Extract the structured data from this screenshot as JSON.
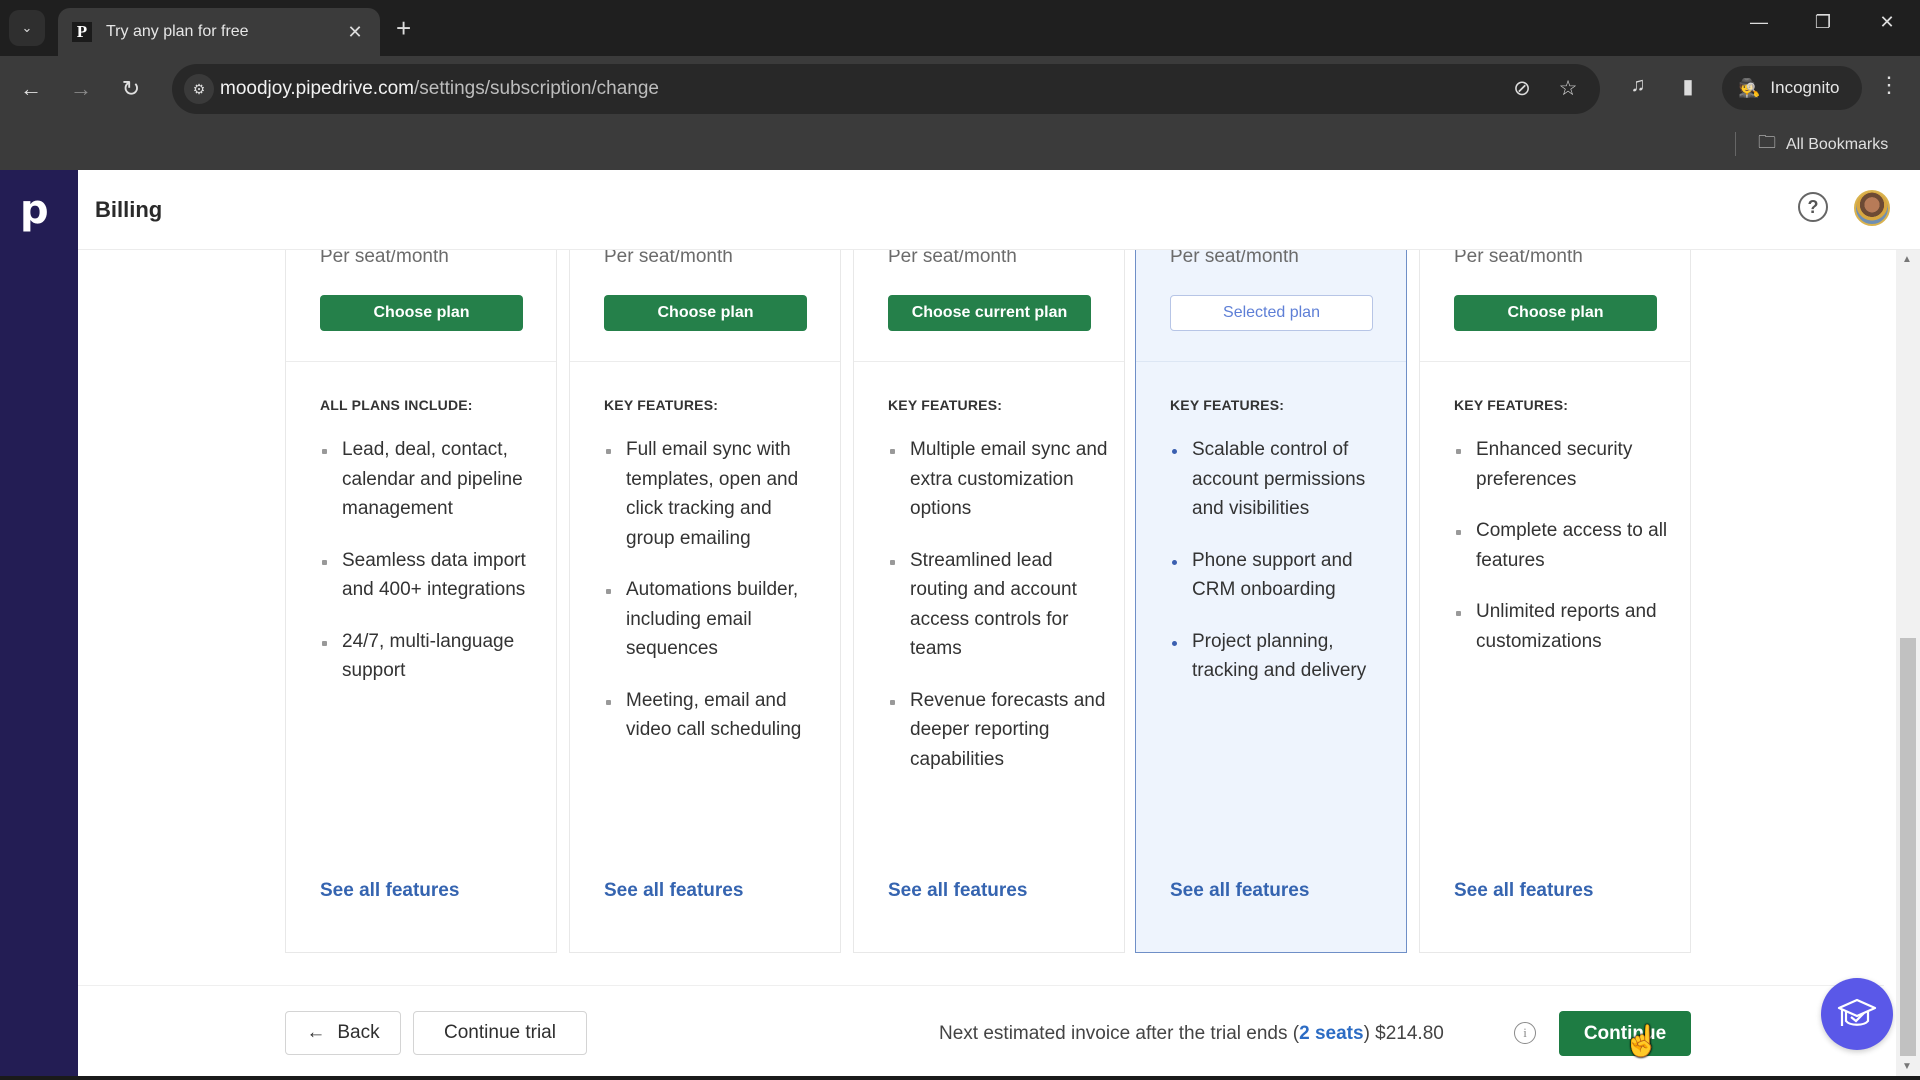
{
  "browser": {
    "tab": {
      "title": "Try any plan for free",
      "favicon": "P"
    },
    "url_host": "moodjoy.pipedrive.com",
    "url_path": "/settings/subscription/change",
    "profile_label": "Incognito",
    "bookmarks_label": "All Bookmarks",
    "icons": {
      "tab_list": "⌄",
      "close_tab": "✕",
      "new_tab": "+",
      "minimize": "—",
      "restore": "❐",
      "close_window": "✕",
      "back": "←",
      "forward": "→",
      "reload": "↻",
      "site_info": "⚙",
      "eye_off": "⊘",
      "star": "☆",
      "media": "♫",
      "side_panel": "▮",
      "incognito": "🕵",
      "menu": "⋮",
      "folder": "🗀"
    }
  },
  "app": {
    "logo": "p",
    "page_title": "Billing",
    "help_icon": "?"
  },
  "plans": [
    {
      "price_unit": "Per seat/month",
      "button_label": "Choose plan",
      "button_state": "choose",
      "features_heading": "ALL PLANS INCLUDE:",
      "features": [
        "Lead, deal, contact, calendar and pipeline management",
        "Seamless data import and 400+ integrations",
        "24/7, multi-language support"
      ],
      "see_all": "See all features"
    },
    {
      "price_unit": "Per seat/month",
      "button_label": "Choose plan",
      "button_state": "choose",
      "features_heading": "KEY FEATURES:",
      "features": [
        "Full email sync with templates, open and click tracking and group emailing",
        "Automations builder, including email sequences",
        "Meeting, email and video call scheduling"
      ],
      "see_all": "See all features"
    },
    {
      "price_unit": "Per seat/month",
      "button_label": "Choose current plan",
      "button_state": "current",
      "features_heading": "KEY FEATURES:",
      "features": [
        "Multiple email sync and extra customization options",
        "Streamlined lead routing and account access controls for teams",
        "Revenue forecasts and deeper reporting capabilities"
      ],
      "see_all": "See all features"
    },
    {
      "price_unit": "Per seat/month",
      "button_label": "Selected plan",
      "button_state": "selected",
      "features_heading": "KEY FEATURES:",
      "features": [
        "Scalable control of account permissions and visibilities",
        "Phone support and CRM onboarding",
        "Project planning, tracking and delivery"
      ],
      "see_all": "See all features"
    },
    {
      "price_unit": "Per seat/month",
      "button_label": "Choose plan",
      "button_state": "choose",
      "features_heading": "KEY FEATURES:",
      "features": [
        "Enhanced security preferences",
        "Complete access to all features",
        "Unlimited reports and customizations"
      ],
      "see_all": "See all features"
    }
  ],
  "footer": {
    "back_label": "Back",
    "back_icon": "←",
    "continue_trial_label": "Continue trial",
    "invoice_prefix": "Next estimated invoice after the trial ends (",
    "invoice_seats": "2 seats",
    "invoice_suffix": ") $214.80",
    "info_icon": "i",
    "continue_label": "Continue"
  },
  "colors": {
    "sidebar": "#231d54",
    "primary_green": "#25804a",
    "link_blue": "#3564b0",
    "selected_card_bg": "#eef4fd",
    "academy_button": "#5a58e8"
  }
}
